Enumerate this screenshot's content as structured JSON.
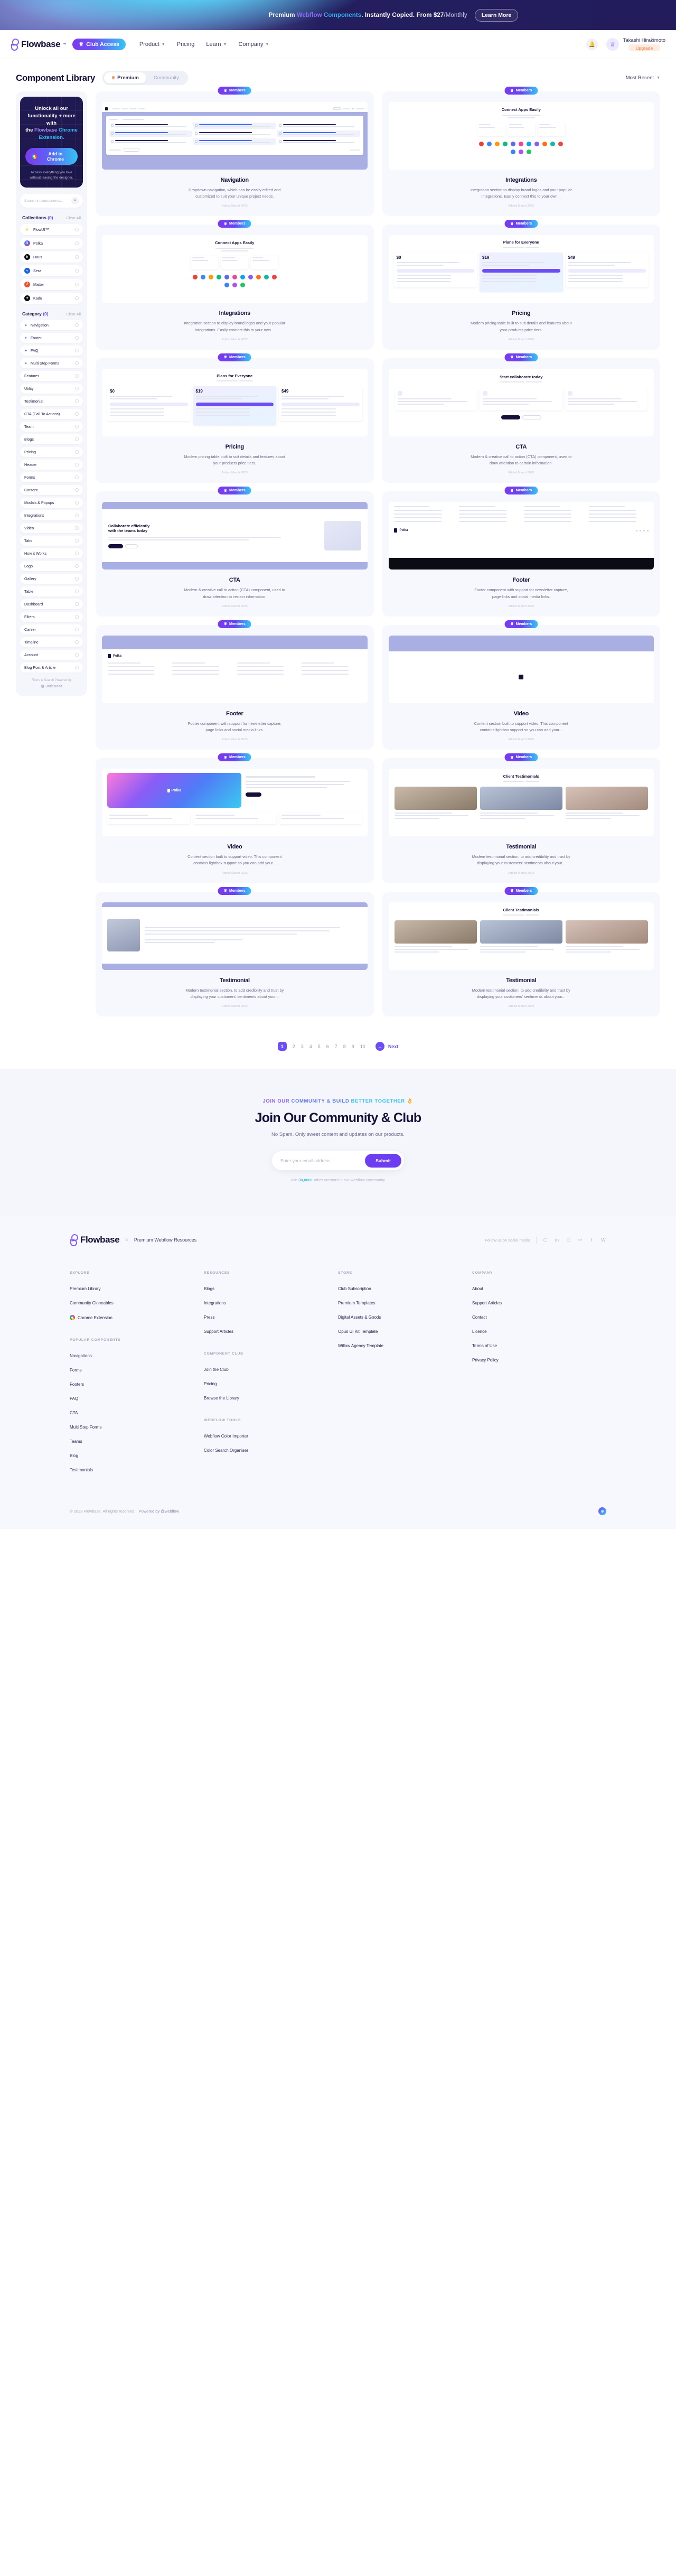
{
  "banner": {
    "text_1": "Premium ",
    "text_webflow": "Webflow",
    "text_components": " Components",
    "text_2": ". Instantly Copied. From $27",
    "text_3": "/Monthly",
    "button": "Learn More"
  },
  "nav": {
    "brand": "Flowbase",
    "brand_tm": "™",
    "club_access": "Club Access",
    "links": [
      {
        "label": "Product",
        "caret": true
      },
      {
        "label": "Pricing",
        "caret": false
      },
      {
        "label": "Learn",
        "caret": true
      },
      {
        "label": "Company",
        "caret": true
      }
    ],
    "bell_icon": "bell-icon",
    "user_name": "Takashi Hirakimoto",
    "upgrade_label": "Upgrade"
  },
  "header": {
    "title": "Component Library",
    "tabs": [
      {
        "label": "Premium",
        "active": true
      },
      {
        "label": "Community",
        "active": false
      }
    ],
    "sort_label": "Most Recent"
  },
  "promo": {
    "line1": "Unlock all our",
    "line2": "functionality + more with",
    "line3_pre": "the ",
    "line3_a": "Flowbase",
    "line3_b": " Chrome",
    "line4": "Extension.",
    "button": "Add to Chrome",
    "footnote": "Access everything you love without leaving the designer."
  },
  "search": {
    "placeholder": "Search in components...",
    "icon": "search-icon"
  },
  "collections": {
    "title": "Collections",
    "count": "(0)",
    "clear": "Clear All",
    "items": [
      {
        "label": "FlowUI™",
        "color": "#ffffff",
        "glyph": "⚡"
      },
      {
        "label": "Polka",
        "color": "#4f46e5",
        "glyph": "Ⅱ"
      },
      {
        "label": "Haus",
        "color": "#0b0b14",
        "glyph": "h"
      },
      {
        "label": "Sera",
        "color": "#1763e8",
        "glyph": "«"
      },
      {
        "label": "Matter",
        "color": "#f04f34",
        "glyph": "⫽"
      },
      {
        "label": "Kadu",
        "color": "#0b0b14",
        "glyph": "✦"
      }
    ]
  },
  "category": {
    "title": "Category",
    "count": "(0)",
    "clear": "Clear All",
    "items": [
      {
        "label": "Navigation",
        "star": true
      },
      {
        "label": "Footer",
        "star": true
      },
      {
        "label": "FAQ",
        "star": true
      },
      {
        "label": "Multi Step Forms",
        "star": true
      },
      {
        "label": "Features",
        "star": false
      },
      {
        "label": "Utility",
        "star": false
      },
      {
        "label": "Testimonial",
        "star": false
      },
      {
        "label": "CTA (Call To Actions)",
        "star": false
      },
      {
        "label": "Team",
        "star": false
      },
      {
        "label": "Blogs",
        "star": false
      },
      {
        "label": "Pricing",
        "star": false
      },
      {
        "label": "Header",
        "star": false
      },
      {
        "label": "Forms",
        "star": false
      },
      {
        "label": "Content",
        "star": false
      },
      {
        "label": "Modals & Popups",
        "star": false
      },
      {
        "label": "Integrations",
        "star": false
      },
      {
        "label": "Video",
        "star": false
      },
      {
        "label": "Tabs",
        "star": false
      },
      {
        "label": "How it Works",
        "star": false
      },
      {
        "label": "Logo",
        "star": false
      },
      {
        "label": "Gallery",
        "star": false
      },
      {
        "label": "Table",
        "star": false
      },
      {
        "label": "Dashboard",
        "star": false
      },
      {
        "label": "Filters",
        "star": false
      },
      {
        "label": "Career",
        "star": false
      },
      {
        "label": "Timeline",
        "star": false
      },
      {
        "label": "Account",
        "star": false
      },
      {
        "label": "Blog Post & Article",
        "star": false
      }
    ]
  },
  "jetboost": {
    "line1": "Filters & Search Powered by",
    "line2": "Jetboost"
  },
  "cards": [
    {
      "badge": "Members",
      "title": "Navigation",
      "desc": "Dropdown navigation, which can be easily edited and customized to suit your unique project needs.",
      "added": "Added March 2023",
      "thumb": "navigation"
    },
    {
      "badge": "Members",
      "title": "Integrations",
      "desc": "Integration section to display brand logos and your popular integrations. Easily connect this to your own...",
      "added": "Added March 2023",
      "thumb": "integrations"
    },
    {
      "badge": "Members",
      "title": "Integrations",
      "desc": "Integration section to display brand logos and your popular integrations. Easily connect this to your own...",
      "added": "Added March 2023",
      "thumb": "integrations"
    },
    {
      "badge": "Members",
      "title": "Pricing",
      "desc": "Modern pricing table built to suit details and features about your products price tiers.",
      "added": "Added March 2023",
      "thumb": "pricing"
    },
    {
      "badge": "Members",
      "title": "Pricing",
      "desc": "Modern pricing table built to suit details and features about your products price tiers.",
      "added": "Added March 2023",
      "thumb": "pricing"
    },
    {
      "badge": "Members",
      "title": "CTA",
      "desc": "Modern & creative call to action (CTA) component, used to draw attention to certain information.",
      "added": "Added March 2023",
      "thumb": "cta-collab"
    },
    {
      "badge": "Members",
      "title": "CTA",
      "desc": "Modern & creative call to action (CTA) component, used to draw attention to certain information.",
      "added": "Added March 2023",
      "thumb": "cta-efficient"
    },
    {
      "badge": "Members",
      "title": "Footer",
      "desc": "Footer component with support for newsletter capture, page links and social media links.",
      "added": "Added March 2023",
      "thumb": "footer-dark"
    },
    {
      "badge": "Members",
      "title": "Footer",
      "desc": "Footer component with support for newsletter capture, page links and social media links.",
      "added": "Added March 2023",
      "thumb": "footer-light"
    },
    {
      "badge": "Members",
      "title": "Video",
      "desc": "Content section built to support video. This component contains lightbox support so you can add your...",
      "added": "Added March 2023",
      "thumb": "video-gradient"
    },
    {
      "badge": "Members",
      "title": "Video",
      "desc": "Content section built to support video. This component contains lightbox support so you can add your...",
      "added": "Added March 2023",
      "thumb": "video-blue"
    },
    {
      "badge": "Members",
      "title": "Testimonial",
      "desc": "Modern testimonial section, to add credibility and trust by displaying your customers' sentiments about your...",
      "added": "Added March 2023",
      "thumb": "testimonial-clients"
    },
    {
      "badge": "Members",
      "title": "Testimonial",
      "desc": "Modern testimonial section, to add credibility and trust by displaying your customers' sentiments about your...",
      "added": "Added March 2023",
      "thumb": "testimonial-portrait"
    },
    {
      "badge": "Members",
      "title": "Testimonial",
      "desc": "Modern testimonial section, to add credibility and trust by displaying your customers' sentiments about your...",
      "added": "Added March 2023",
      "thumb": "testimonial-clients"
    }
  ],
  "thumb_text": {
    "connect_apps": "Connect Apps Easily",
    "plans_everyone": "Plans for Everyone",
    "start_collab": "Start collaborate today",
    "collab_eff_1": "Collaborate efficiently",
    "collab_eff_2": "with the teams today",
    "client_testimonials": "Client Testimonials",
    "polka": "Polka"
  },
  "pagination": {
    "pages": [
      "1",
      "2",
      "3",
      "4",
      "5",
      "6",
      "7",
      "8",
      "9",
      "10"
    ],
    "current": "1",
    "next": "Next",
    "next_icon": "arrow-right-icon"
  },
  "community": {
    "eyebrow_1": "JOIN OUR",
    "eyebrow_2": " COMMUNITY & BUILD",
    "eyebrow_3": " BETTER TOGETHER",
    "eyebrow_emoji": "👌",
    "title": "Join Our Community & Club",
    "subtitle": "No Spam. Only sweet content and updates on our products.",
    "email_placeholder": "Enter your email address",
    "submit": "Submit",
    "note_pre": "Join ",
    "note_count": "30,000+",
    "note_post": " other creators in our webflow community."
  },
  "footer": {
    "brand": "Flowbase",
    "x": "✕",
    "tagline": "Premium Webflow Resources",
    "social_label": "Follow us on social media",
    "social_icons": [
      "discord-icon",
      "linkedin-icon",
      "instagram-icon",
      "twitter-icon",
      "facebook-icon",
      "webflow-icon"
    ],
    "columns": [
      {
        "groups": [
          {
            "heading": "EXPLORE",
            "links": [
              {
                "label": "Premium Library",
                "icon": null
              },
              {
                "label": "Community Cloneables",
                "icon": null
              },
              {
                "label": "Chrome Extension",
                "icon": "chrome-icon"
              }
            ]
          },
          {
            "heading": "POPULAR COMPONENTS",
            "links": [
              {
                "label": "Navigations",
                "icon": null
              },
              {
                "label": "Forms",
                "icon": null
              },
              {
                "label": "Footers",
                "icon": null
              },
              {
                "label": "FAQ",
                "icon": null
              },
              {
                "label": "CTA",
                "icon": null
              },
              {
                "label": "Multi Step Forms",
                "icon": null
              },
              {
                "label": "Teams",
                "icon": null
              },
              {
                "label": "Blog",
                "icon": null
              },
              {
                "label": "Testimonials",
                "icon": null
              }
            ]
          }
        ]
      },
      {
        "groups": [
          {
            "heading": "RESOURCES",
            "links": [
              {
                "label": "Blogs",
                "icon": null
              },
              {
                "label": "Integrations",
                "icon": null
              },
              {
                "label": "Press",
                "icon": null
              },
              {
                "label": "Support Articles",
                "icon": null
              }
            ]
          },
          {
            "heading": "COMPONENT CLUB",
            "links": [
              {
                "label": "Join the Club",
                "icon": null
              },
              {
                "label": "Pricing",
                "icon": null
              },
              {
                "label": "Browse the Library",
                "icon": null
              }
            ]
          },
          {
            "heading": "WEBFLOW TOOLS",
            "links": [
              {
                "label": "Webflow Color Importer",
                "icon": null
              },
              {
                "label": "Color Search Organiser",
                "icon": null
              }
            ]
          }
        ]
      },
      {
        "groups": [
          {
            "heading": "STORE",
            "links": [
              {
                "label": "Club Subscription",
                "icon": null
              },
              {
                "label": "Premium Templates",
                "icon": null
              },
              {
                "label": "Digital Assets & Goods",
                "icon": null
              },
              {
                "label": "Opus UI Kit Template",
                "icon": null
              },
              {
                "label": "Willow Agency Template",
                "icon": null
              }
            ]
          }
        ]
      },
      {
        "groups": [
          {
            "heading": "COMPANY",
            "links": [
              {
                "label": "About",
                "icon": null
              },
              {
                "label": "Support Articles",
                "icon": null
              },
              {
                "label": "Contact",
                "icon": null
              },
              {
                "label": "Licence",
                "icon": null
              },
              {
                "label": "Terms of Use",
                "icon": null
              },
              {
                "label": "Privacy Policy",
                "icon": null
              }
            ]
          }
        ]
      }
    ],
    "copyright": "© 2023 Flowbase. All rights reserved.",
    "powered": "Powered by @webflow",
    "globe_icon": "globe-icon"
  },
  "colors": {
    "accent_purple": "#6d4df6",
    "accent_blue": "#35c4f4",
    "dark": "#14103a",
    "bg_light": "#f4f6fc",
    "card_bg": "#f7f8fd",
    "orange": "#f0793a"
  }
}
